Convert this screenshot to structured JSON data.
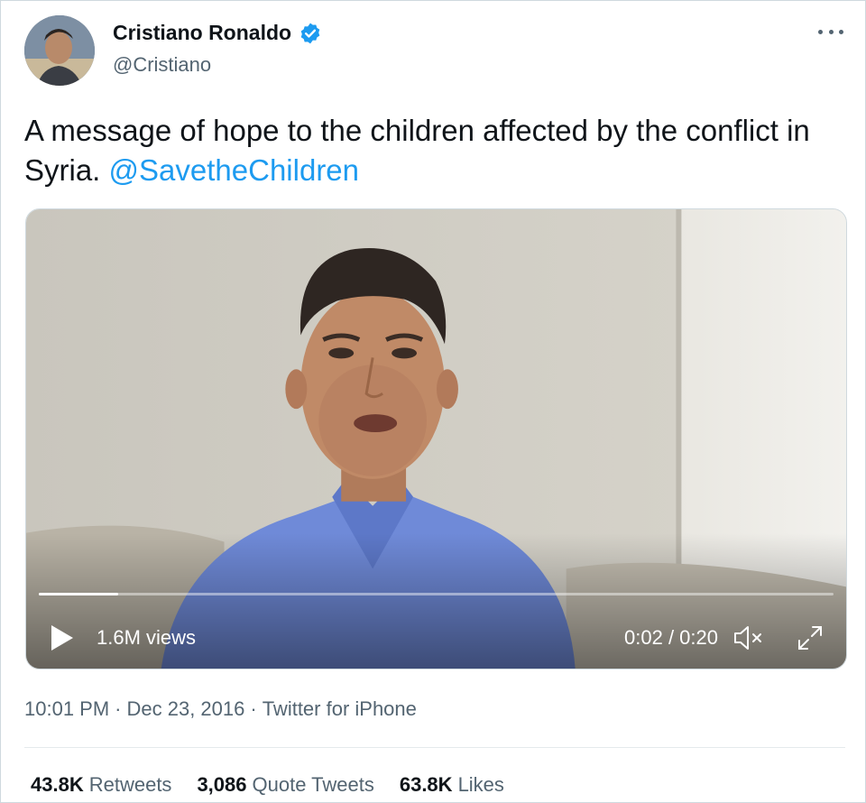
{
  "author": {
    "name": "Cristiano Ronaldo",
    "handle": "@Cristiano"
  },
  "tweet": {
    "text": "A message of hope to the children affected by the conflict in Syria.",
    "mention": "@SavetheChildren"
  },
  "video": {
    "views": "1.6M views",
    "time": "0:02 / 0:20",
    "progress": 0.1
  },
  "meta": {
    "time": "10:01 PM",
    "separator": "·",
    "date": "Dec 23, 2016",
    "source": "Twitter for iPhone"
  },
  "stats": [
    {
      "count": "43.8K",
      "label": "Retweets"
    },
    {
      "count": "3,086",
      "label": "Quote Tweets"
    },
    {
      "count": "63.8K",
      "label": "Likes"
    }
  ],
  "colors": {
    "accent": "#1d9bf0",
    "text": "#0f1419",
    "secondary": "#536471"
  },
  "icons": [
    "verified-badge-icon",
    "more-icon",
    "play-icon",
    "mute-icon",
    "fullscreen-icon"
  ]
}
